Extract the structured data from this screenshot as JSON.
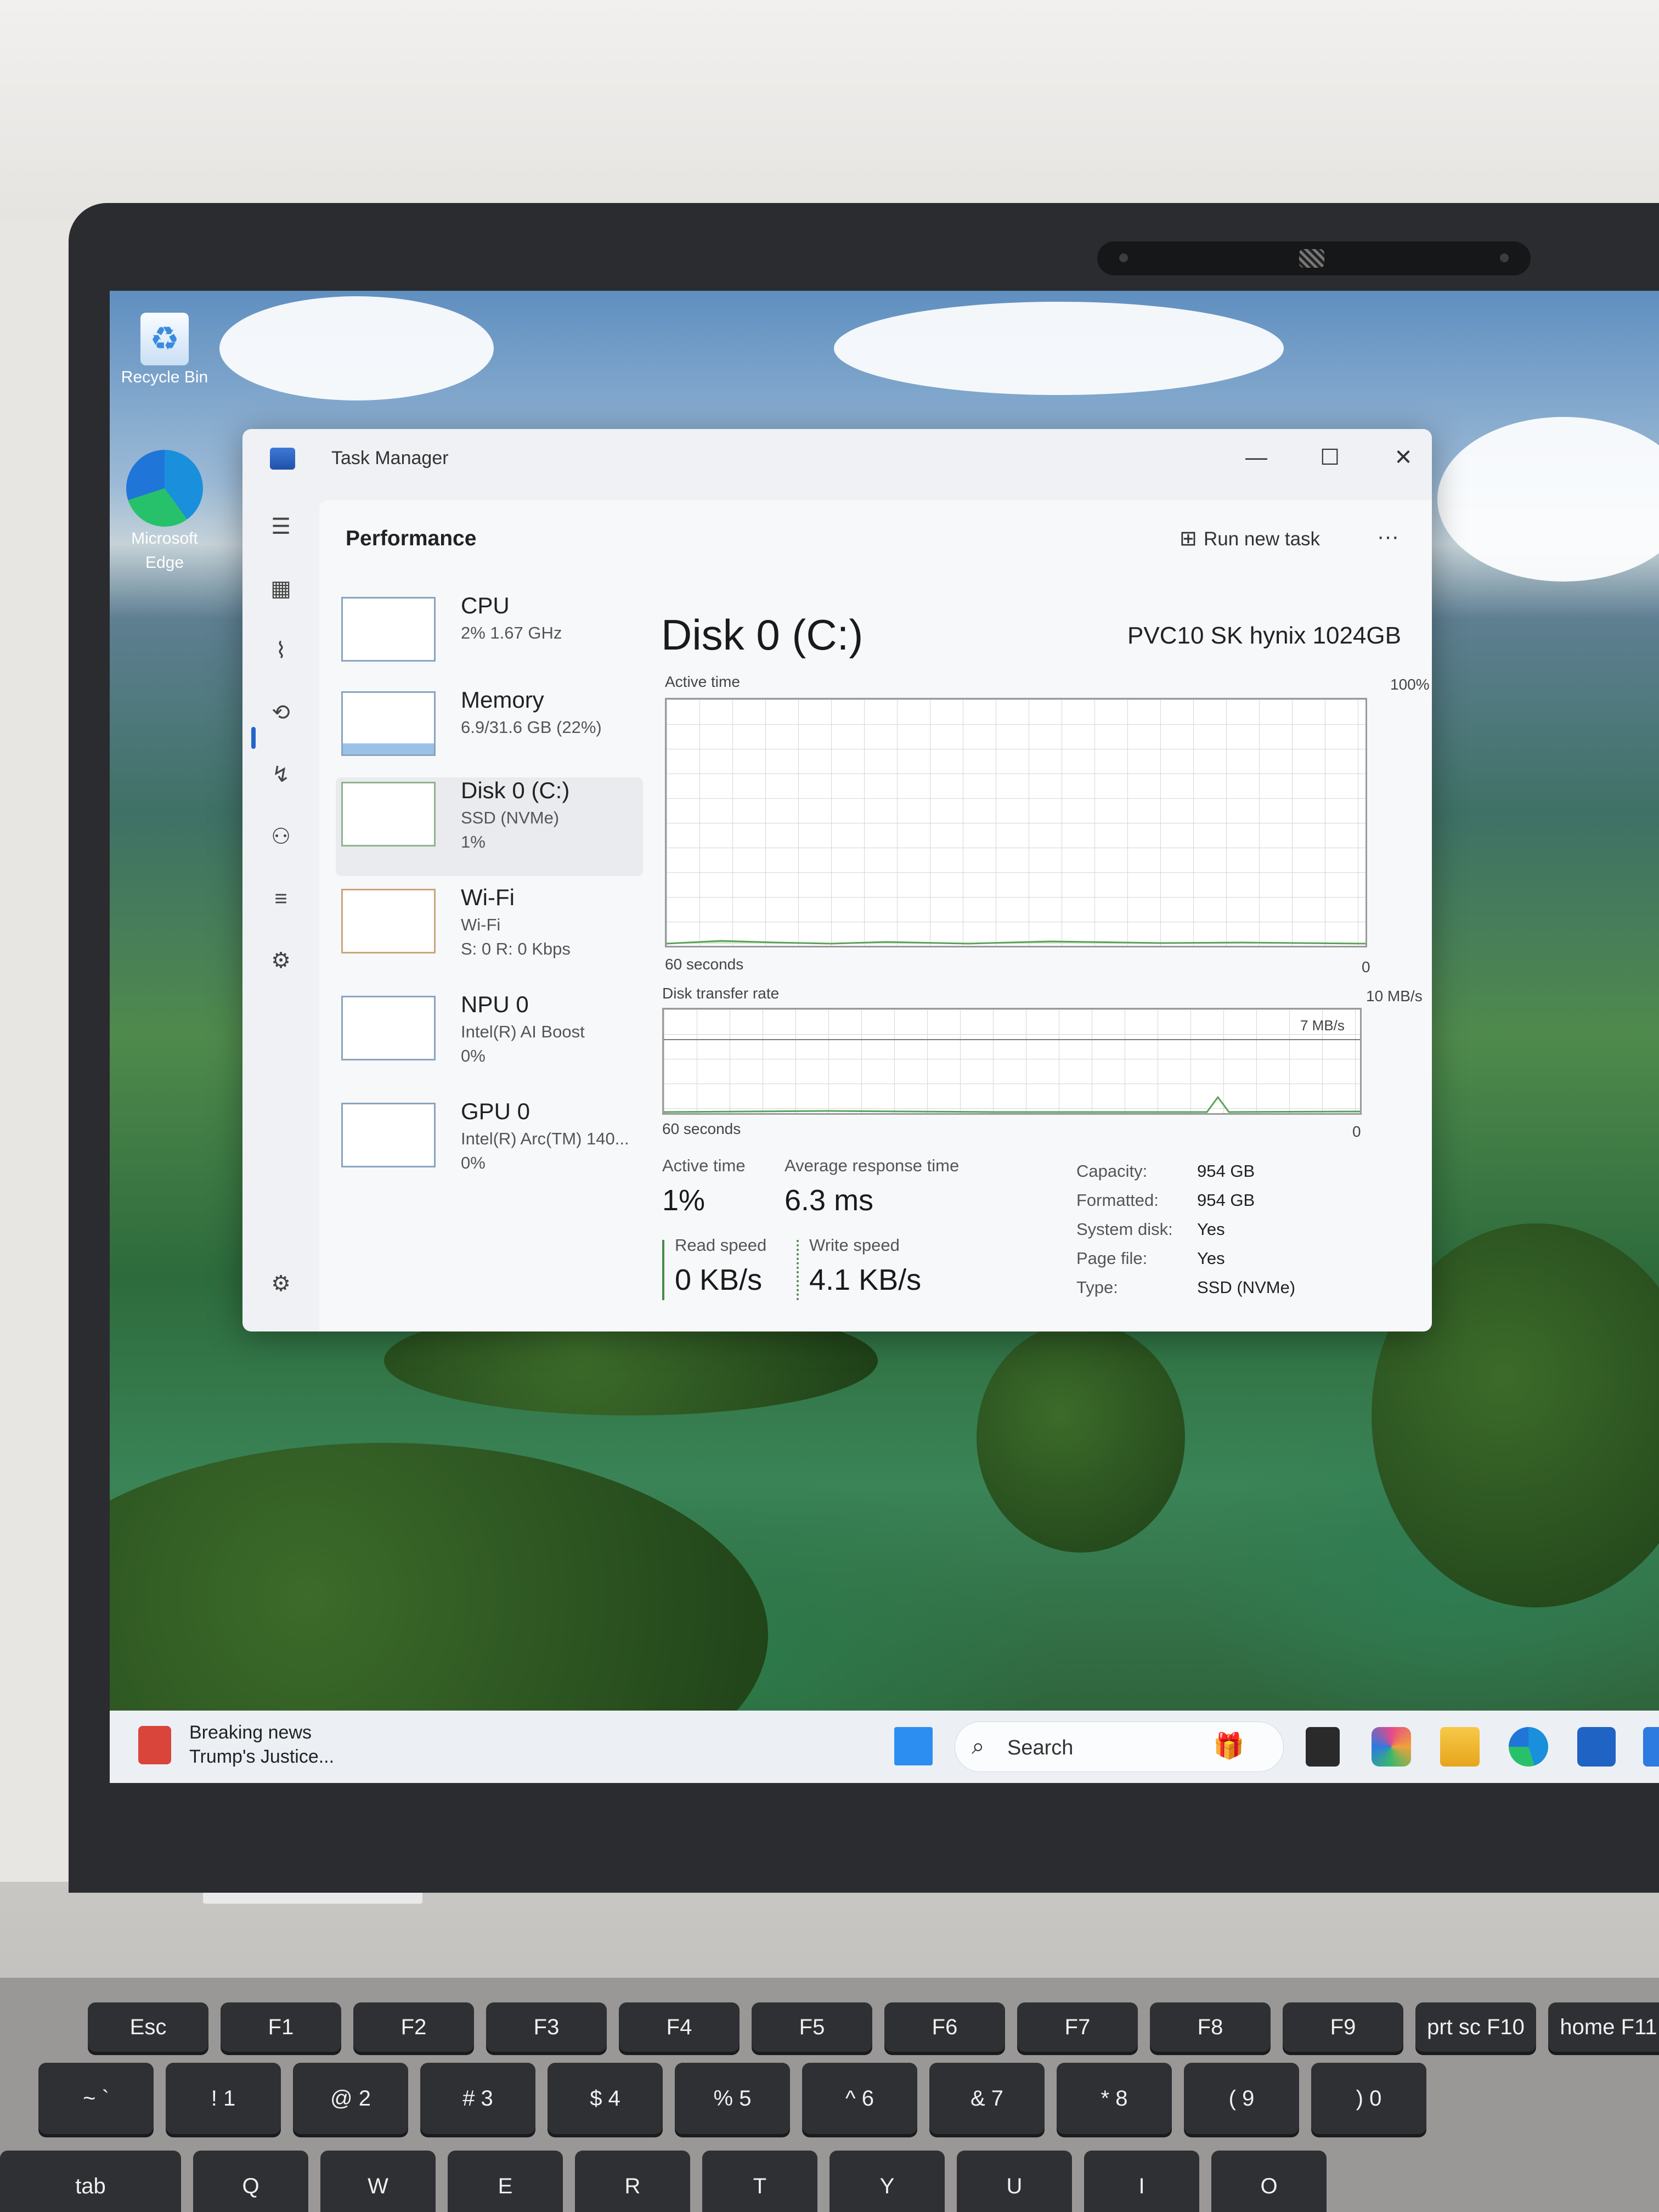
{
  "desktop": {
    "recycle_bin_label": "Recycle Bin",
    "edge_label": "Microsoft Edge"
  },
  "window": {
    "title": "Task Manager",
    "minimize": "—",
    "maximize": "☐",
    "close": "✕"
  },
  "nav_icons": [
    "hamburger-icon",
    "processes-icon",
    "performance-icon",
    "app-history-icon",
    "startup-apps-icon",
    "users-icon",
    "details-icon",
    "services-icon",
    "settings-icon"
  ],
  "header": {
    "title": "Performance",
    "run_new_task": "Run new task",
    "more": "···"
  },
  "resources": [
    {
      "name": "CPU",
      "line1": "2% 1.67 GHz",
      "line2": ""
    },
    {
      "name": "Memory",
      "line1": "6.9/31.6 GB (22%)",
      "line2": ""
    },
    {
      "name": "Disk 0 (C:)",
      "line1": "SSD (NVMe)",
      "line2": "1%"
    },
    {
      "name": "Wi-Fi",
      "line1": "Wi-Fi",
      "line2": "S: 0 R: 0 Kbps"
    },
    {
      "name": "NPU 0",
      "line1": "Intel(R) AI Boost",
      "line2": "0%"
    },
    {
      "name": "GPU 0",
      "line1": "Intel(R) Arc(TM) 140...",
      "line2": "0%"
    }
  ],
  "detail": {
    "title": "Disk 0 (C:)",
    "model": "PVC10 SK hynix 1024GB",
    "active_time_label": "Active time",
    "active_time_max": "100%",
    "active_time_span": "60 seconds",
    "active_time_min": "0",
    "transfer_label": "Disk transfer rate",
    "transfer_max": "10 MB/s",
    "transfer_line": "7 MB/s",
    "transfer_span": "60 seconds",
    "transfer_min": "0",
    "stats": {
      "active_time_label": "Active time",
      "active_time_value": "1%",
      "avg_response_label": "Average response time",
      "avg_response_value": "6.3 ms",
      "read_label": "Read speed",
      "read_value": "0 KB/s",
      "write_label": "Write speed",
      "write_value": "4.1 KB/s"
    },
    "props": [
      {
        "k": "Capacity:",
        "v": "954 GB"
      },
      {
        "k": "Formatted:",
        "v": "954 GB"
      },
      {
        "k": "System disk:",
        "v": "Yes"
      },
      {
        "k": "Page file:",
        "v": "Yes"
      },
      {
        "k": "Type:",
        "v": "SSD (NVMe)"
      }
    ]
  },
  "taskbar": {
    "news_title": "Breaking news",
    "news_sub": "Trump's Justice...",
    "search_placeholder": "Search"
  },
  "keyboard": {
    "fn_row": [
      "Esc",
      "F1",
      "F2",
      "F3",
      "F4",
      "F5",
      "F6",
      "F7",
      "F8",
      "F9",
      "prt sc F10",
      "home F11"
    ],
    "num_row": [
      "~ `",
      "! 1",
      "@ 2",
      "# 3",
      "$ 4",
      "% 5",
      "^ 6",
      "& 7",
      "* 8",
      "( 9",
      ") 0"
    ],
    "q_row": [
      "tab",
      "Q",
      "W",
      "E",
      "R",
      "T",
      "Y",
      "U",
      "I",
      "O"
    ]
  }
}
